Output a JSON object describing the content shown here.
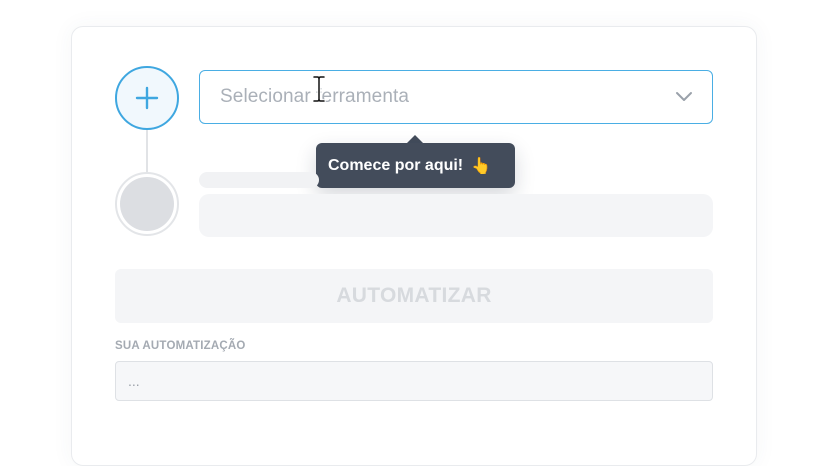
{
  "steps": {
    "first": {
      "icon": "plus-icon"
    },
    "second": {
      "icon": "placeholder-circle"
    }
  },
  "tool_select": {
    "placeholder": "Selecionar ferramenta",
    "icon": "chevron-down-icon"
  },
  "tooltip": {
    "text": "Comece por aqui!",
    "emoji": "👆"
  },
  "automate_button": {
    "label": "AUTOMATIZAR"
  },
  "result": {
    "label": "SUA AUTOMATIZAÇÃO",
    "value": "..."
  },
  "colors": {
    "accent": "#3fa7e0",
    "tooltip_bg": "#434c5b",
    "disabled_bg": "#f4f5f7",
    "disabled_text": "#d7dade"
  }
}
